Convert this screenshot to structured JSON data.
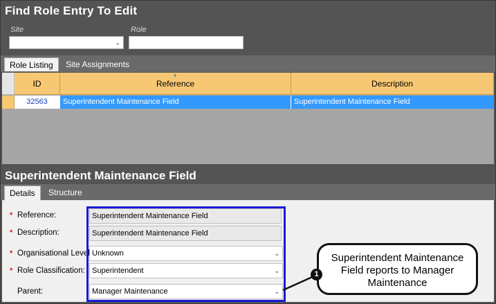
{
  "finder": {
    "title": "Find Role Entry To Edit",
    "site_label": "Site",
    "site_value": "",
    "role_label": "Role",
    "role_value": ""
  },
  "top_tabs": [
    {
      "label": "Role Listing",
      "active": true
    },
    {
      "label": "Site Assignments",
      "active": false
    }
  ],
  "grid": {
    "columns": [
      "ID",
      "Reference",
      "Description"
    ],
    "rows": [
      {
        "id": "32563",
        "reference": "Superintendent Maintenance Field",
        "description": "Superintendent Maintenance Field",
        "selected": true
      }
    ]
  },
  "detail": {
    "title": "Superintendent Maintenance Field",
    "tabs": [
      {
        "label": "Details",
        "active": true
      },
      {
        "label": "Structure",
        "active": false
      }
    ],
    "fields": {
      "reference": {
        "label": "Reference:",
        "value": "Superintendent Maintenance Field",
        "required": true
      },
      "description": {
        "label": "Description:",
        "value": "Superintendent Maintenance Field",
        "required": true
      },
      "org_level": {
        "label": "Organisational Level:",
        "value": "Unknown",
        "required": true
      },
      "role_class": {
        "label": "Role Classification:",
        "value": "Superintendent",
        "required": true
      },
      "parent": {
        "label": "Parent:",
        "value": "Manager Maintenance",
        "required": false
      }
    }
  },
  "callout": {
    "number": "1",
    "text": "Superintendent Maintenance Field reports to Manager Maintenance"
  },
  "colors": {
    "highlight_border": "#1a1ad6",
    "header_orange": "#f7c873",
    "row_selected": "#3399ff",
    "required_star": "#d81c1c"
  }
}
